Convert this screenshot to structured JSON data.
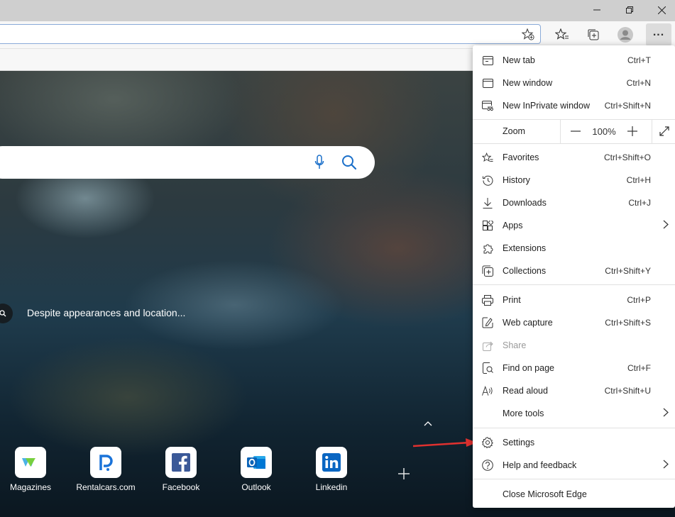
{
  "page": {
    "caption": "Despite appearances and location...",
    "tiles": [
      {
        "label": "Magazines",
        "icon": "magazines-icon"
      },
      {
        "label": "Rentalcars.com",
        "icon": "rentalcars-icon"
      },
      {
        "label": "Facebook",
        "icon": "facebook-icon"
      },
      {
        "label": "Outlook",
        "icon": "outlook-icon"
      },
      {
        "label": "Linkedin",
        "icon": "linkedin-icon"
      }
    ]
  },
  "menu": {
    "items": [
      {
        "label": "New tab",
        "shortcut": "Ctrl+T"
      },
      {
        "label": "New window",
        "shortcut": "Ctrl+N"
      },
      {
        "label": "New InPrivate window",
        "shortcut": "Ctrl+Shift+N"
      },
      {
        "label": "Favorites",
        "shortcut": "Ctrl+Shift+O"
      },
      {
        "label": "History",
        "shortcut": "Ctrl+H"
      },
      {
        "label": "Downloads",
        "shortcut": "Ctrl+J"
      },
      {
        "label": "Apps",
        "shortcut": ""
      },
      {
        "label": "Extensions",
        "shortcut": ""
      },
      {
        "label": "Collections",
        "shortcut": "Ctrl+Shift+Y"
      },
      {
        "label": "Print",
        "shortcut": "Ctrl+P"
      },
      {
        "label": "Web capture",
        "shortcut": "Ctrl+Shift+S"
      },
      {
        "label": "Share",
        "shortcut": ""
      },
      {
        "label": "Find on page",
        "shortcut": "Ctrl+F"
      },
      {
        "label": "Read aloud",
        "shortcut": "Ctrl+Shift+U"
      },
      {
        "label": "More tools",
        "shortcut": ""
      },
      {
        "label": "Settings",
        "shortcut": ""
      },
      {
        "label": "Help and feedback",
        "shortcut": ""
      },
      {
        "label": "Close Microsoft Edge",
        "shortcut": ""
      }
    ],
    "zoom": {
      "label": "Zoom",
      "minus": "—",
      "value": "100%",
      "plus": "+"
    }
  },
  "colors": {
    "accent_arrow": "#e0312f",
    "menu_bg": "#ffffff",
    "titlebar": "#cfcfcf"
  }
}
